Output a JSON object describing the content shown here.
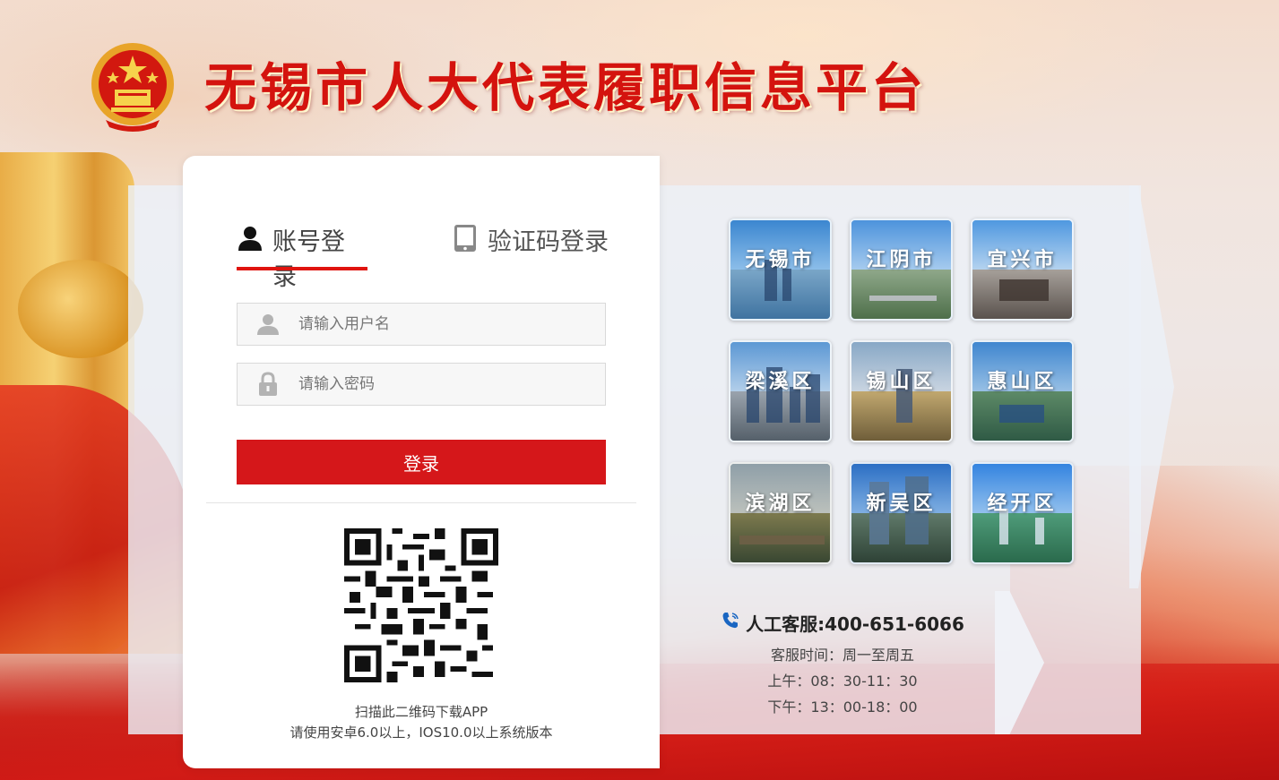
{
  "header": {
    "title": "无锡市人大代表履职信息平台",
    "emblem_icon": "national-emblem-icon"
  },
  "login": {
    "tabs": [
      {
        "label": "账号登录",
        "icon": "user-icon",
        "active": true
      },
      {
        "label": "验证码登录",
        "icon": "tablet-icon",
        "active": false
      }
    ],
    "username": {
      "value": "",
      "placeholder": "请输入用户名",
      "icon": "user-icon"
    },
    "password": {
      "value": "",
      "placeholder": "请输入密码",
      "icon": "lock-icon"
    },
    "submit_label": "登录",
    "qr_caption": "扫描此二维码下载APP",
    "qr_requirement": "请使用安卓6.0以上，IOS10.0以上系统版本",
    "accent_color": "#d5171a"
  },
  "districts": [
    {
      "label": "无锡市"
    },
    {
      "label": "江阴市"
    },
    {
      "label": "宜兴市"
    },
    {
      "label": "梁溪区"
    },
    {
      "label": "锡山区"
    },
    {
      "label": "惠山区"
    },
    {
      "label": "滨湖区"
    },
    {
      "label": "新吴区"
    },
    {
      "label": "经开区"
    }
  ],
  "service": {
    "hotline": "人工客服:400-651-6066",
    "hours": "客服时间：周一至周五",
    "morning": "上午：08：30-11：30",
    "afternoon": "下午：13：00-18：00",
    "icon": "phone-icon"
  }
}
